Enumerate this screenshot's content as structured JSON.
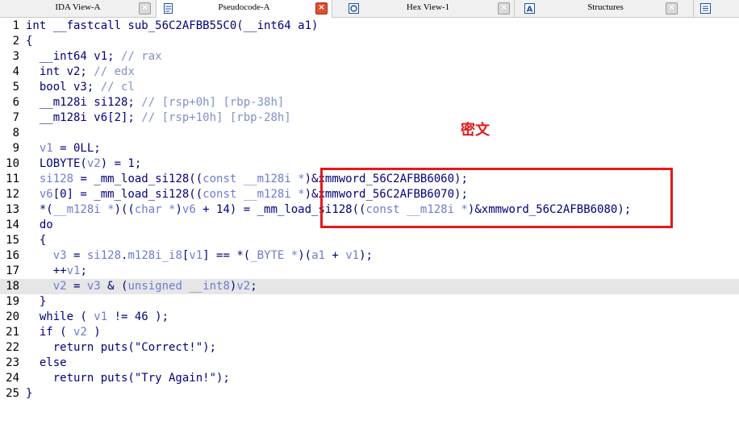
{
  "tabs": [
    {
      "label": "IDA View-A",
      "icon": "ida-view-icon",
      "active": false
    },
    {
      "label": "Pseudocode-A",
      "icon": "pseudocode-icon",
      "active": true
    },
    {
      "label": "Hex View-1",
      "icon": "hex-view-icon",
      "active": false
    },
    {
      "label": "Structures",
      "icon": "structures-icon",
      "active": false
    }
  ],
  "annotation": "密文",
  "colors": {
    "keyword": "#000080",
    "variable": "#6c7cd0",
    "comment": "#8090c8",
    "highlight_box": "#e31a1a",
    "current_line": "#e6e6e6"
  },
  "code_lines": [
    {
      "n": "1",
      "segs": [
        [
          "k",
          "int __fastcall sub_56C2AFBB55C0(__int64 a1)"
        ]
      ]
    },
    {
      "n": "2",
      "segs": [
        [
          "k",
          "{"
        ]
      ]
    },
    {
      "n": "3",
      "segs": [
        [
          "k",
          "  __int64 v1; "
        ],
        [
          "c",
          "// rax"
        ]
      ]
    },
    {
      "n": "4",
      "segs": [
        [
          "k",
          "  int v2; "
        ],
        [
          "c",
          "// edx"
        ]
      ]
    },
    {
      "n": "5",
      "segs": [
        [
          "k",
          "  bool v3; "
        ],
        [
          "c",
          "// cl"
        ]
      ]
    },
    {
      "n": "6",
      "segs": [
        [
          "k",
          "  __m128i si128; "
        ],
        [
          "c",
          "// [rsp+0h] [rbp-38h]"
        ]
      ]
    },
    {
      "n": "7",
      "segs": [
        [
          "k",
          "  __m128i v6[2]; "
        ],
        [
          "c",
          "// [rsp+10h] [rbp-28h]"
        ]
      ]
    },
    {
      "n": "8",
      "segs": [
        [
          "k",
          ""
        ]
      ]
    },
    {
      "n": "9",
      "segs": [
        [
          "k",
          "  "
        ],
        [
          "v",
          "v1"
        ],
        [
          "k",
          " = 0LL;"
        ]
      ]
    },
    {
      "n": "10",
      "segs": [
        [
          "k",
          "  LOBYTE("
        ],
        [
          "v",
          "v2"
        ],
        [
          "k",
          ") = 1;"
        ]
      ]
    },
    {
      "n": "11",
      "segs": [
        [
          "k",
          "  "
        ],
        [
          "v",
          "si128"
        ],
        [
          "k",
          " = _mm_load_si128(("
        ],
        [
          "v",
          "const __m128i *"
        ],
        [
          "k",
          ")&xmmword_56C2AFBB6060);"
        ]
      ]
    },
    {
      "n": "12",
      "segs": [
        [
          "k",
          "  "
        ],
        [
          "v",
          "v6"
        ],
        [
          "k",
          "[0] = _mm_load_si128(("
        ],
        [
          "v",
          "const __m128i *"
        ],
        [
          "k",
          ")&xmmword_56C2AFBB6070);"
        ]
      ]
    },
    {
      "n": "13",
      "segs": [
        [
          "k",
          "  *("
        ],
        [
          "v",
          "__m128i *"
        ],
        [
          "k",
          ")(("
        ],
        [
          "v",
          "char *"
        ],
        [
          "k",
          ")"
        ],
        [
          "v",
          "v6"
        ],
        [
          "k",
          " + 14) = _mm_load_si128(("
        ],
        [
          "v",
          "const __m128i *"
        ],
        [
          "k",
          ")&xmmword_56C2AFBB6080);"
        ]
      ]
    },
    {
      "n": "14",
      "segs": [
        [
          "k",
          "  do"
        ]
      ]
    },
    {
      "n": "15",
      "segs": [
        [
          "k",
          "  {"
        ]
      ]
    },
    {
      "n": "16",
      "segs": [
        [
          "k",
          "    "
        ],
        [
          "v",
          "v3"
        ],
        [
          "k",
          " = "
        ],
        [
          "v",
          "si128"
        ],
        [
          "k",
          "."
        ],
        [
          "v",
          "m128i_i8"
        ],
        [
          "k",
          "["
        ],
        [
          "v",
          "v1"
        ],
        [
          "k",
          "] == *("
        ],
        [
          "v",
          "_BYTE *"
        ],
        [
          "k",
          ")("
        ],
        [
          "v",
          "a1"
        ],
        [
          "k",
          " + "
        ],
        [
          "v",
          "v1"
        ],
        [
          "k",
          ");"
        ]
      ]
    },
    {
      "n": "17",
      "segs": [
        [
          "k",
          "    ++"
        ],
        [
          "v",
          "v1"
        ],
        [
          "k",
          ";"
        ]
      ]
    },
    {
      "n": "18",
      "segs": [
        [
          "k",
          "    "
        ],
        [
          "v",
          "v2"
        ],
        [
          "k",
          " = "
        ],
        [
          "v",
          "v3"
        ],
        [
          "k",
          " & ("
        ],
        [
          "v",
          "unsigned __int8"
        ],
        [
          "k",
          ")"
        ],
        [
          "v",
          "v2"
        ],
        [
          "k",
          ";"
        ]
      ]
    },
    {
      "n": "19",
      "segs": [
        [
          "k",
          "  }"
        ]
      ]
    },
    {
      "n": "20",
      "segs": [
        [
          "k",
          "  while ( "
        ],
        [
          "v",
          "v1"
        ],
        [
          "k",
          " != 46 );"
        ]
      ]
    },
    {
      "n": "21",
      "segs": [
        [
          "k",
          "  if ( "
        ],
        [
          "v",
          "v2"
        ],
        [
          "k",
          " )"
        ]
      ]
    },
    {
      "n": "22",
      "segs": [
        [
          "k",
          "    return puts(\"Correct!\");"
        ]
      ]
    },
    {
      "n": "23",
      "segs": [
        [
          "k",
          "  else"
        ]
      ]
    },
    {
      "n": "24",
      "segs": [
        [
          "k",
          "    return puts(\"Try Again!\");"
        ]
      ]
    },
    {
      "n": "25",
      "segs": [
        [
          "k",
          "}"
        ]
      ]
    }
  ],
  "highlighted_line": "18"
}
